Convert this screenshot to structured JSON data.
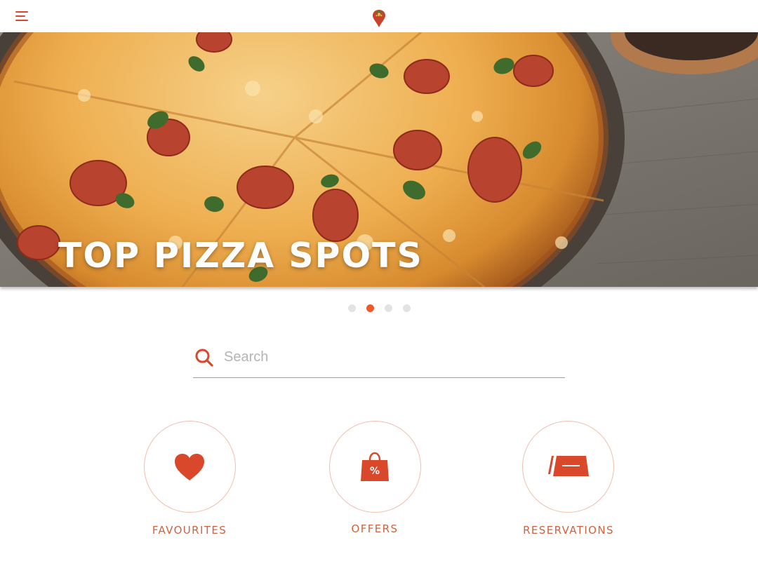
{
  "header": {
    "menu_icon": "hamburger-menu-icon",
    "logo_icon": "pizza-location-pin-icon"
  },
  "hero": {
    "title": "TOP PIZZA SPOTS",
    "image": "pepperoni-pizza-on-wooden-table"
  },
  "carousel": {
    "dots": 4,
    "active_index": 1
  },
  "search": {
    "placeholder": "Search",
    "value": "",
    "icon": "search-icon"
  },
  "features": [
    {
      "label": "FAVOURITES",
      "icon": "heart-icon"
    },
    {
      "label": "OFFERS",
      "icon": "shopping-bag-percent-icon"
    },
    {
      "label": "RESERVATIONS",
      "icon": "reserved-table-sign-icon"
    }
  ],
  "colors": {
    "accent": "#d9482b",
    "circle_border": "#f0bfae",
    "label": "#d2623d",
    "dot_inactive": "#e3e3e3",
    "dot_active": "#ee5a2f"
  }
}
